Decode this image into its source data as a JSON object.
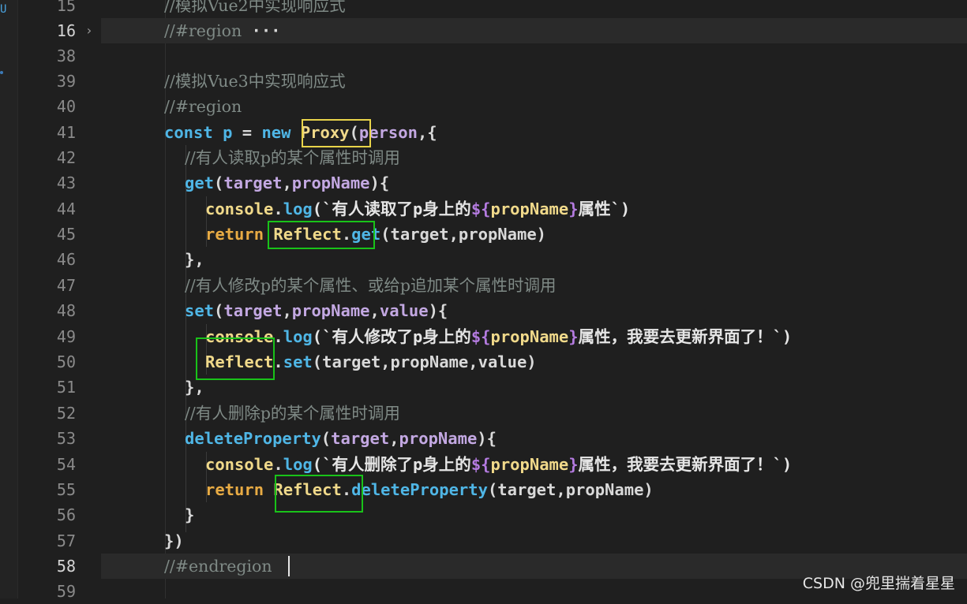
{
  "activity_letter": "U",
  "watermark": "CSDN @兜里揣着星星",
  "lines": {
    "l15": {
      "num": "15",
      "code": "//模拟Vue2中实现响应式"
    },
    "l16": {
      "num": "16",
      "fold": "›",
      "code": "//#region",
      "ellipsis": "···"
    },
    "l38": {
      "num": "38"
    },
    "l39": {
      "num": "39",
      "code": "//模拟Vue3中实现响应式"
    },
    "l40": {
      "num": "40",
      "code": "//#region"
    },
    "l41": {
      "num": "41",
      "t1": "const",
      "t2": "p",
      "t3": " = ",
      "t4": "new",
      "t5": "Proxy",
      "t6": "(",
      "t7": "person",
      "t8": ",{"
    },
    "l42": {
      "num": "42",
      "code": "//有人读取p的某个属性时调用"
    },
    "l43": {
      "num": "43",
      "t1": "get",
      "t2": "(",
      "t3": "target",
      "t4": ",",
      "t5": "propName",
      "t6": "){"
    },
    "l44": {
      "num": "44",
      "t1": "console",
      "t2": ".",
      "t3": "log",
      "t4": "(`有人读取了p身上的",
      "t5": "${",
      "t6": "propName",
      "t7": "}",
      "t8": "属性`)"
    },
    "l45": {
      "num": "45",
      "t1": "return",
      "t2": "Reflect",
      "t3": ".",
      "t4": "get",
      "t5": "(target,propName)"
    },
    "l46": {
      "num": "46",
      "code": "},"
    },
    "l47": {
      "num": "47",
      "code": "//有人修改p的某个属性、或给p追加某个属性时调用"
    },
    "l48": {
      "num": "48",
      "t1": "set",
      "t2": "(",
      "t3": "target",
      "t4": ",",
      "t5": "propName",
      "t6": ",",
      "t7": "value",
      "t8": "){"
    },
    "l49": {
      "num": "49",
      "t1": "console",
      "t2": ".",
      "t3": "log",
      "t4": "(`有人修改了p身上的",
      "t5": "${",
      "t6": "propName",
      "t7": "}",
      "t8": "属性，我要去更新界面了！`)"
    },
    "l50": {
      "num": "50",
      "t1": "Reflect",
      "t2": ".",
      "t3": "set",
      "t4": "(target,propName,value)"
    },
    "l51": {
      "num": "51",
      "code": "},"
    },
    "l52": {
      "num": "52",
      "code": "//有人删除p的某个属性时调用"
    },
    "l53": {
      "num": "53",
      "t1": "deleteProperty",
      "t2": "(",
      "t3": "target",
      "t4": ",",
      "t5": "propName",
      "t6": "){"
    },
    "l54": {
      "num": "54",
      "t1": "console",
      "t2": ".",
      "t3": "log",
      "t4": "(`有人删除了p身上的",
      "t5": "${",
      "t6": "propName",
      "t7": "}",
      "t8": "属性，我要去更新界面了！`)"
    },
    "l55": {
      "num": "55",
      "t1": "return",
      "t2": "Reflect",
      "t3": ".",
      "t4": "deleteProperty",
      "t5": "(target,propName)"
    },
    "l56": {
      "num": "56",
      "code": "}"
    },
    "l57": {
      "num": "57",
      "code": "})"
    },
    "l58": {
      "num": "58",
      "code": "//#endregion"
    },
    "l59": {
      "num": "59"
    }
  }
}
